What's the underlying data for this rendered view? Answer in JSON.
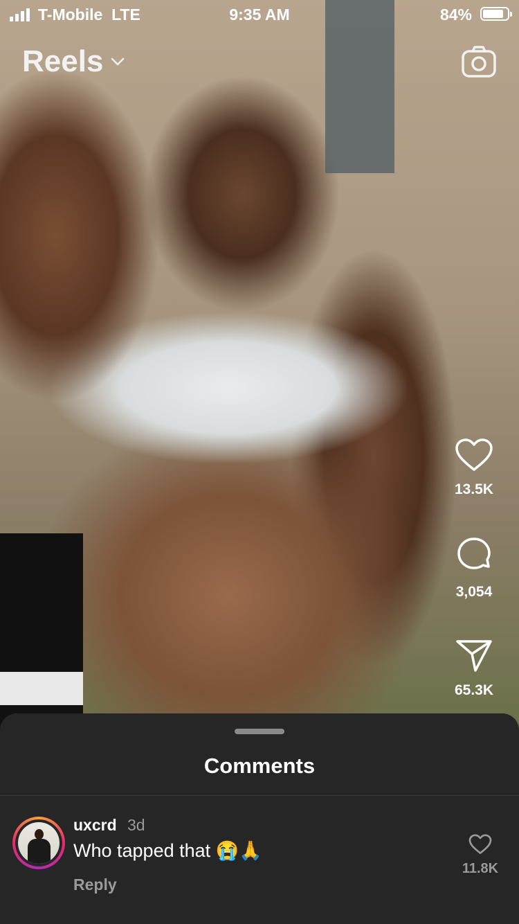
{
  "status_bar": {
    "carrier": "T-Mobile",
    "network": "LTE",
    "time": "9:35 AM",
    "battery_pct": "84%",
    "battery_level": 0.84
  },
  "header": {
    "title": "Reels"
  },
  "actions": {
    "likes": "13.5K",
    "comments": "3,054",
    "shares": "65.3K"
  },
  "comments_sheet": {
    "title": "Comments",
    "comments": [
      {
        "username": "uxcrd",
        "time_ago": "3d",
        "text": "Who tapped that 😭🙏",
        "reply_label": "Reply",
        "likes": "11.8K"
      }
    ]
  },
  "icons": {
    "header": "chevron-down-icon",
    "camera": "camera-icon",
    "like": "heart-icon",
    "comment": "comment-bubble-icon",
    "share": "paper-plane-icon"
  }
}
